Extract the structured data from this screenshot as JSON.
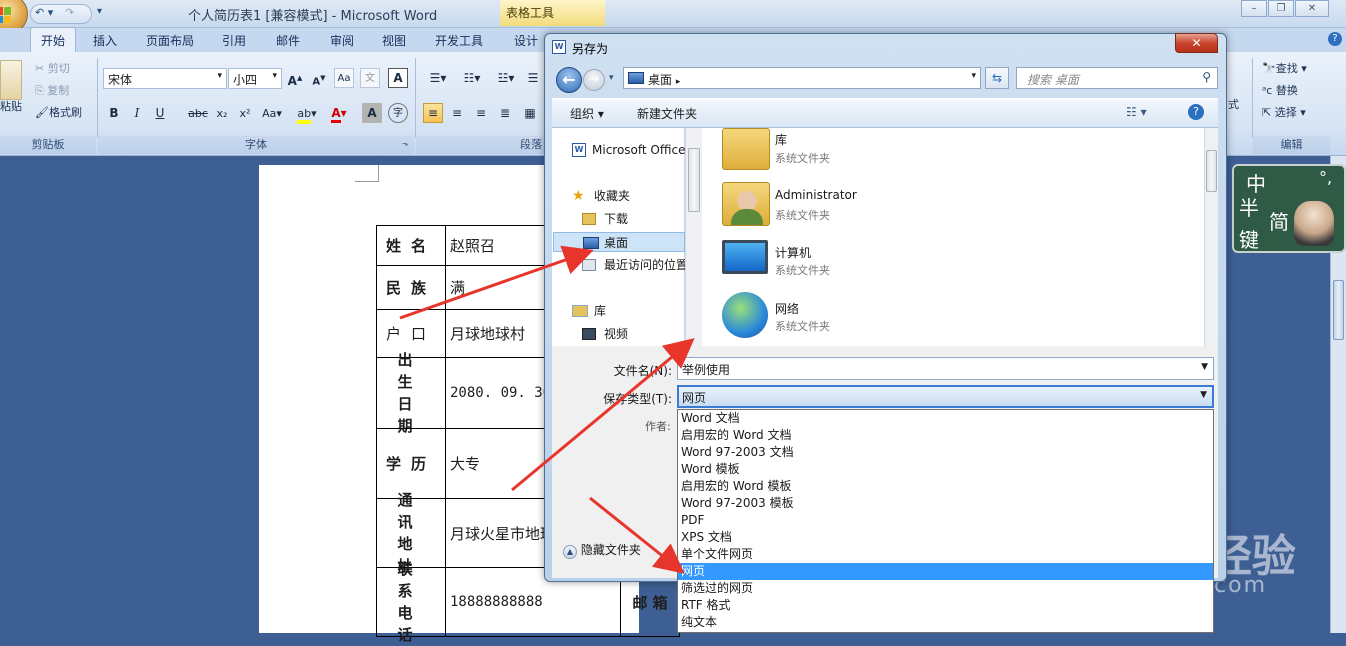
{
  "word": {
    "title": "个人简历表1 [兼容模式] - Microsoft Word",
    "context_tab": "表格工具",
    "tabs": [
      "开始",
      "插入",
      "页面布局",
      "引用",
      "邮件",
      "审阅",
      "视图",
      "开发工具",
      "设计"
    ],
    "clipboard": {
      "paste": "粘贴",
      "cut": "剪切",
      "copy": "复制",
      "format_painter": "格式刷",
      "group": "剪贴板"
    },
    "font": {
      "name": "宋体",
      "size": "小四",
      "group": "字体"
    },
    "paragraph": {
      "group": "段落"
    },
    "editing": {
      "find": "查找",
      "replace": "替换",
      "select": "选择",
      "group": "编辑",
      "style_partial": "式"
    }
  },
  "resume": {
    "rows": [
      {
        "label": "姓名",
        "value": "赵照召"
      },
      {
        "label": "民族",
        "value": "满"
      },
      {
        "label": "户口",
        "value": "月球地球村"
      },
      {
        "label": "出生日期",
        "value": "2080. 09. 30"
      },
      {
        "label": "学历",
        "value": "大专"
      },
      {
        "label": "通讯地址",
        "value": "月球火星市地球"
      },
      {
        "label": "联系电话",
        "value": "18888888888"
      }
    ],
    "email_label": "邮 箱"
  },
  "ime": {
    "chars": [
      "中",
      "半",
      "简",
      "键"
    ],
    "punct": "°,"
  },
  "watermark": {
    "line1": "Bai du 经验",
    "line2": "jingyan.baidu.com"
  },
  "dialog": {
    "title": "另存为",
    "close": "✕",
    "address": "桌面",
    "search_placeholder": "搜索 桌面",
    "toolbar": {
      "organize": "组织",
      "new_folder": "新建文件夹"
    },
    "nav": {
      "office": "Microsoft Office",
      "favorites": "收藏夹",
      "downloads": "下载",
      "desktop": "桌面",
      "recent": "最近访问的位置",
      "libraries": "库",
      "videos": "视频"
    },
    "files": [
      {
        "name": "库",
        "type": "系统文件夹"
      },
      {
        "name": "Administrator",
        "type": "系统文件夹"
      },
      {
        "name": "计算机",
        "type": "系统文件夹"
      },
      {
        "name": "网络",
        "type": "系统文件夹"
      }
    ],
    "filename_label": "文件名(N):",
    "filename_value": "举例使用",
    "filetype_label": "保存类型(T):",
    "filetype_value": "网页",
    "author_label": "作者:",
    "hide_folders": "隐藏文件夹",
    "filetype_options": [
      "Word 文档",
      "启用宏的 Word 文档",
      "Word 97-2003 文档",
      "Word 模板",
      "启用宏的 Word 模板",
      "Word 97-2003 模板",
      "PDF",
      "XPS 文档",
      "单个文件网页",
      "网页",
      "筛选过的网页",
      "RTF 格式",
      "纯文本"
    ],
    "selected_option_index": 9
  },
  "colors": {
    "accent": "#3399ff",
    "annotation_arrow": "#e8352b",
    "ribbon_bg": "#d7e4f4",
    "doc_bg": "#3e5f94"
  }
}
